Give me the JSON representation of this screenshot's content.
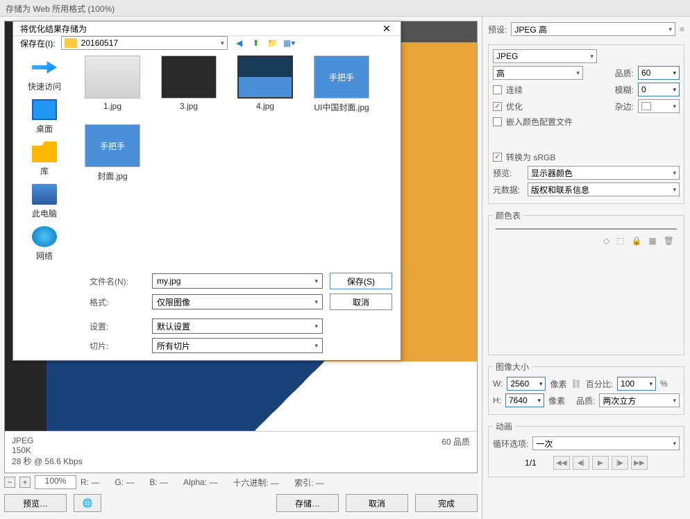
{
  "main": {
    "title": "存储为 Web 所用格式 (100%)",
    "preview_info": {
      "format": "JPEG",
      "size": "150K",
      "time": "28 秒 @ 56.6 Kbps",
      "quality": "60 品质"
    },
    "zoom": {
      "value": "100%",
      "r": "R: —",
      "g": "G: —",
      "b": "B: —",
      "alpha": "Alpha: —",
      "hex": "十六进制: —",
      "index": "索引: —"
    },
    "buttons": {
      "preview": "预览…",
      "save": "存储…",
      "cancel": "取消",
      "done": "完成"
    }
  },
  "right": {
    "preset_label": "预设:",
    "preset_value": "JPEG 高",
    "format_value": "JPEG",
    "quality_level": "高",
    "quality_label": "品质:",
    "quality_value": "60",
    "progressive_label": "连续",
    "blur_label": "模糊:",
    "blur_value": "0",
    "optimize_label": "优化",
    "matte_label": "杂边:",
    "embed_label": "嵌入颜色配置文件",
    "srgb_label": "转换为 sRGB",
    "preview_label": "预览:",
    "preview_value": "显示器颜色",
    "meta_label": "元数据:",
    "meta_value": "版权和联系信息",
    "colortable_title": "颜色表",
    "image_size_title": "图像大小",
    "w_label": "W:",
    "w_value": "2560",
    "h_label": "H:",
    "h_value": "7640",
    "px_label": "像素",
    "percent_label": "百分比:",
    "percent_value": "100",
    "percent_unit": "%",
    "resample_label": "品质:",
    "resample_value": "两次立方",
    "anim_title": "动画",
    "loop_label": "循环选项:",
    "loop_value": "一次",
    "frame": "1/1"
  },
  "dialog": {
    "title": "将优化结果存储为",
    "savein_label": "保存在(I):",
    "folder": "20160517",
    "places": {
      "quick": "快速访问",
      "desktop": "桌面",
      "lib": "库",
      "pc": "此电脑",
      "net": "网络"
    },
    "files": [
      "1.jpg",
      "3.jpg",
      "4.jpg",
      "UI中国封面.jpg",
      "封面.jpg"
    ],
    "thumb_text": {
      "ui": "手把手",
      "fm": "手把手"
    },
    "filename_label": "文件名(N):",
    "filename_value": "my.jpg",
    "format_label": "格式:",
    "format_value": "仅限图像",
    "settings_label": "设置:",
    "settings_value": "默认设置",
    "slice_label": "切片:",
    "slice_value": "所有切片",
    "save_btn": "保存(S)",
    "cancel_btn": "取消"
  }
}
